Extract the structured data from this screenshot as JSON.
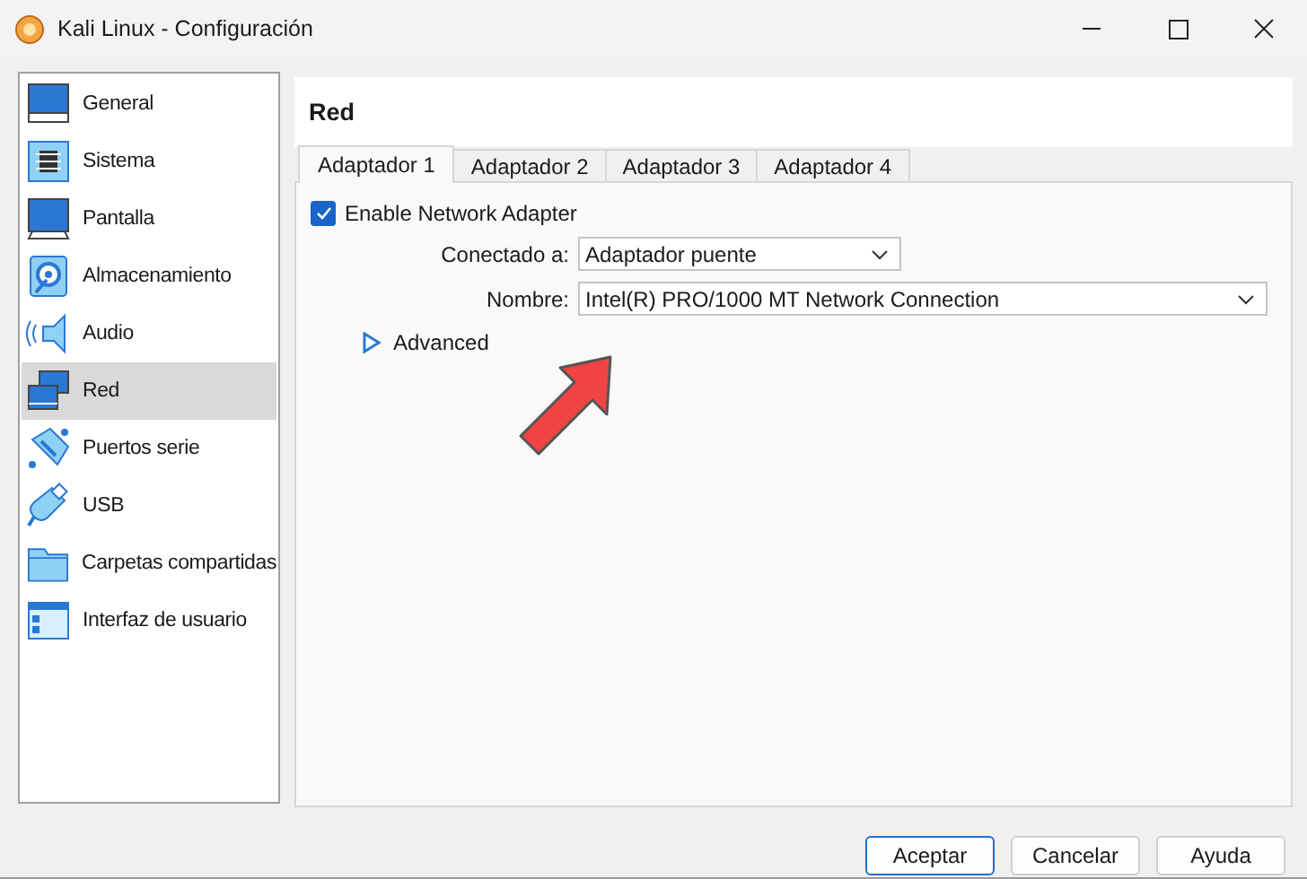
{
  "window": {
    "title": "Kali Linux - Configuración"
  },
  "sidebar": {
    "items": [
      {
        "label": "General",
        "selected": false
      },
      {
        "label": "Sistema",
        "selected": false
      },
      {
        "label": "Pantalla",
        "selected": false
      },
      {
        "label": "Almacenamiento",
        "selected": false
      },
      {
        "label": "Audio",
        "selected": false
      },
      {
        "label": "Red",
        "selected": true
      },
      {
        "label": "Puertos serie",
        "selected": false
      },
      {
        "label": "USB",
        "selected": false
      },
      {
        "label": "Carpetas compartidas",
        "selected": false
      },
      {
        "label": "Interfaz de usuario",
        "selected": false
      }
    ]
  },
  "page": {
    "title": "Red"
  },
  "tabs": [
    {
      "label": "Adaptador 1",
      "selected": true
    },
    {
      "label": "Adaptador 2",
      "selected": false
    },
    {
      "label": "Adaptador 3",
      "selected": false
    },
    {
      "label": "Adaptador 4",
      "selected": false
    }
  ],
  "enable_adapter": {
    "label": "Enable Network Adapter",
    "checked": true
  },
  "fields": [
    {
      "label": "Conectado a:",
      "value": "Adaptador puente"
    },
    {
      "label": "Nombre:",
      "value": "Intel(R) PRO/1000 MT Network Connection"
    }
  ],
  "advanced": {
    "label": "Advanced",
    "expanded": false
  },
  "annotation": {
    "kind": "arrow"
  },
  "buttons": [
    {
      "label": "Aceptar",
      "default": true
    },
    {
      "label": "Cancelar",
      "default": false
    },
    {
      "label": "Ayuda",
      "default": false
    }
  ]
}
